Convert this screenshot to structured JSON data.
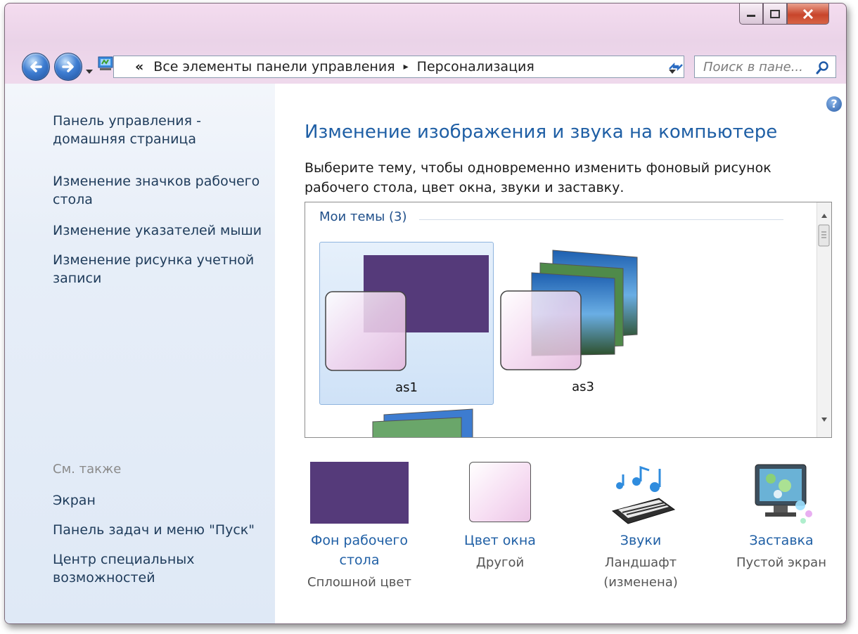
{
  "window": {
    "address": {
      "chevron": "«",
      "crumbs": [
        "Все элементы панели управления",
        "Персонализация"
      ],
      "separator": "▸"
    },
    "search": {
      "placeholder": "Поиск в пане..."
    }
  },
  "sidebar": {
    "links": [
      "Панель управления -\nдомашняя страница",
      "Изменение значков рабочего\nстола",
      "Изменение указателей мыши",
      "Изменение рисунка учетной\nзаписи"
    ],
    "see_also_title": "См. также",
    "see_also": [
      "Экран",
      "Панель задач и меню \"Пуск\"",
      "Центр специальных\nвозможностей"
    ]
  },
  "main": {
    "title": "Изменение изображения и звука на компьютере",
    "description": "Выберите тему, чтобы одновременно изменить фоновый рисунок рабочего стола, цвет окна, звуки и заставку.",
    "group_label": "Мои темы (3)",
    "themes": [
      {
        "name": "as1",
        "selected": true,
        "color": "#553a7a"
      },
      {
        "name": "as3",
        "selected": false
      }
    ],
    "settings": [
      {
        "label": "Фон рабочего\nстола",
        "sub": "Сплошной цвет",
        "icon": "desktop-background-icon",
        "color": "#553a7a"
      },
      {
        "label": "Цвет окна",
        "sub": "Другой",
        "icon": "window-color-icon",
        "color": "#f4d7f0"
      },
      {
        "label": "Звуки",
        "sub": "Ландшафт\n(изменена)",
        "icon": "sounds-icon"
      },
      {
        "label": "Заставка",
        "sub": "Пустой экран",
        "icon": "screensaver-icon"
      }
    ]
  },
  "colors": {
    "link": "#1e3b5a",
    "heading": "#1f5fa5",
    "accent_purple": "#553a7a"
  }
}
